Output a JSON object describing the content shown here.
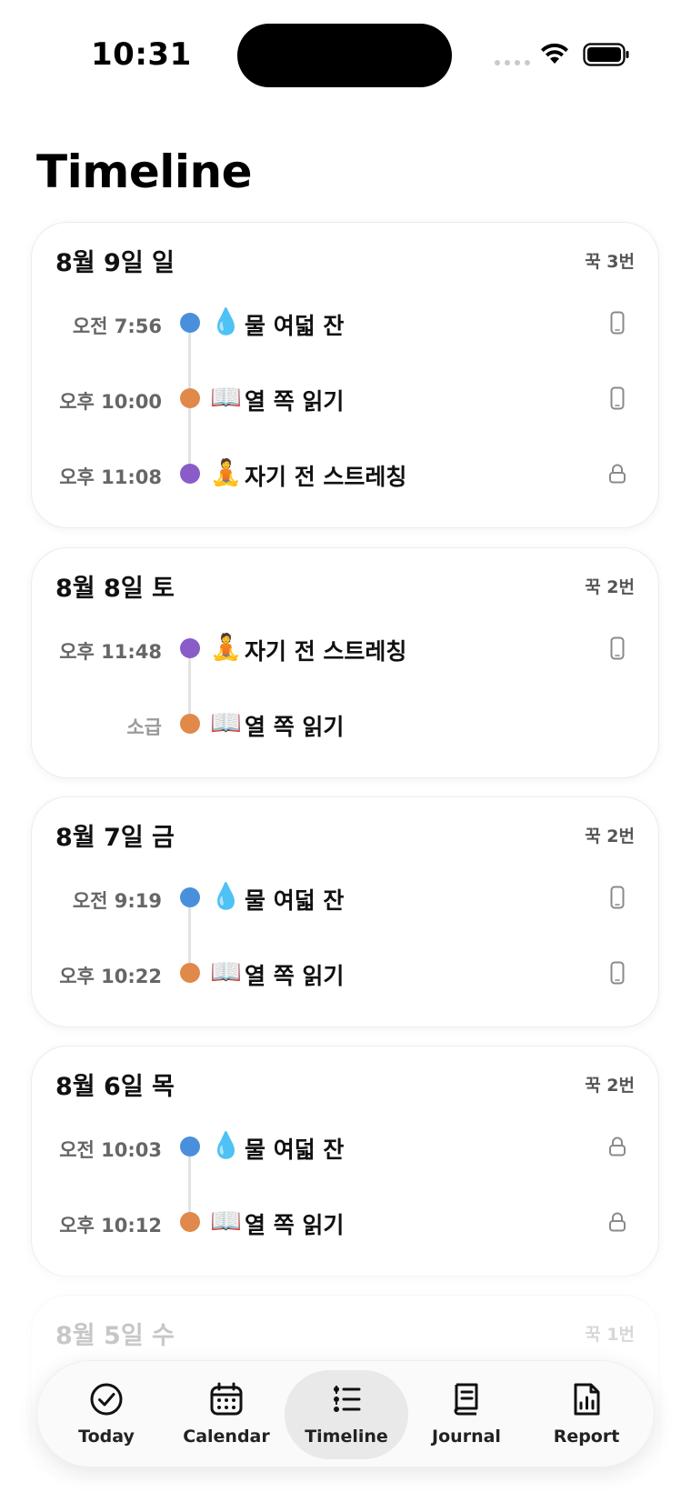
{
  "status_bar": {
    "time": "10:31"
  },
  "page": {
    "title": "Timeline"
  },
  "colors": {
    "blue": "#4a8fdc",
    "orange": "#e0894a",
    "purple": "#8a5cc8"
  },
  "days": [
    {
      "date": "8월 9일 일",
      "count": "꾹 3번",
      "entries": [
        {
          "time": "오전 7:56",
          "emoji": "💧",
          "name": "물 여덟 잔",
          "dot": "blue",
          "source_icon": "phone-icon"
        },
        {
          "time": "오후 10:00",
          "emoji": "📖",
          "name": "열 쪽 읽기",
          "dot": "orange",
          "source_icon": "phone-icon"
        },
        {
          "time": "오후 11:08",
          "emoji": "🧘",
          "name": "자기 전 스트레칭",
          "dot": "purple",
          "source_icon": "lock-icon"
        }
      ]
    },
    {
      "date": "8월 8일 토",
      "count": "꾹 2번",
      "entries": [
        {
          "time": "오후 11:48",
          "emoji": "🧘",
          "name": "자기 전 스트레칭",
          "dot": "purple",
          "source_icon": "phone-icon"
        },
        {
          "time": "소급",
          "emoji": "📖",
          "name": "열 쪽 읽기",
          "dot": "orange",
          "source_icon": ""
        }
      ]
    },
    {
      "date": "8월 7일 금",
      "count": "꾹 2번",
      "entries": [
        {
          "time": "오전 9:19",
          "emoji": "💧",
          "name": "물 여덟 잔",
          "dot": "blue",
          "source_icon": "phone-icon"
        },
        {
          "time": "오후 10:22",
          "emoji": "📖",
          "name": "열 쪽 읽기",
          "dot": "orange",
          "source_icon": "phone-icon"
        }
      ]
    },
    {
      "date": "8월 6일 목",
      "count": "꾹 2번",
      "entries": [
        {
          "time": "오전 10:03",
          "emoji": "💧",
          "name": "물 여덟 잔",
          "dot": "blue",
          "source_icon": "lock-icon"
        },
        {
          "time": "오후 10:12",
          "emoji": "📖",
          "name": "열 쪽 읽기",
          "dot": "orange",
          "source_icon": "lock-icon"
        }
      ]
    },
    {
      "date": "8월 5일 수",
      "count": "꾹 1번",
      "entries": []
    }
  ],
  "tab_bar": {
    "active": "timeline",
    "tabs": [
      {
        "id": "today",
        "label": "Today",
        "icon": "check-circle-icon"
      },
      {
        "id": "calendar",
        "label": "Calendar",
        "icon": "calendar-icon"
      },
      {
        "id": "timeline",
        "label": "Timeline",
        "icon": "timeline-list-icon"
      },
      {
        "id": "journal",
        "label": "Journal",
        "icon": "journal-icon"
      },
      {
        "id": "report",
        "label": "Report",
        "icon": "report-chart-icon"
      }
    ]
  }
}
